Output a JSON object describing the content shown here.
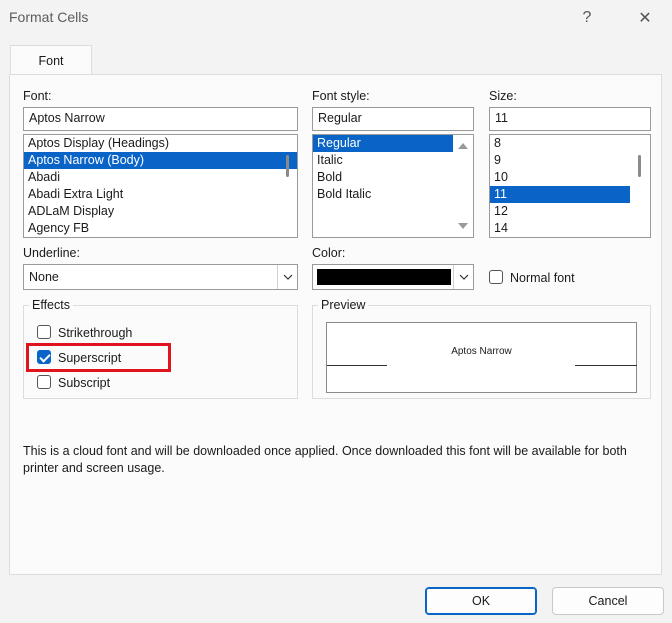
{
  "window": {
    "title": "Format Cells",
    "help_glyph": "?",
    "close_glyph": "✕"
  },
  "tabs": [
    {
      "label": "Font"
    }
  ],
  "font": {
    "label": "Font:",
    "value": "Aptos Narrow",
    "items": [
      "Aptos Display (Headings)",
      "Aptos Narrow (Body)",
      "Abadi",
      "Abadi Extra Light",
      "ADLaM Display",
      "Agency FB"
    ],
    "selected_index": 1
  },
  "font_style": {
    "label": "Font style:",
    "value": "Regular",
    "items": [
      "Regular",
      "Italic",
      "Bold",
      "Bold Italic"
    ],
    "selected_index": 0
  },
  "size": {
    "label": "Size:",
    "value": "11",
    "items": [
      "8",
      "9",
      "10",
      "11",
      "12",
      "14"
    ],
    "selected_index": 3
  },
  "underline": {
    "label": "Underline:",
    "value": "None"
  },
  "color": {
    "label": "Color:",
    "value_color": "#000000"
  },
  "normal_font": {
    "label": "Normal font",
    "checked": false
  },
  "effects": {
    "title": "Effects",
    "strikethrough": {
      "label": "Strikethrough",
      "checked": false
    },
    "superscript": {
      "label": "Superscript",
      "checked": true
    },
    "subscript": {
      "label": "Subscript",
      "checked": false
    }
  },
  "preview": {
    "title": "Preview",
    "sample_text": "Aptos Narrow"
  },
  "info_text": "This is a cloud font and will be downloaded once applied. Once downloaded this font will be available for both printer and screen usage.",
  "buttons": {
    "ok": "OK",
    "cancel": "Cancel"
  },
  "colors": {
    "selection": "#0a64c8",
    "highlight_box": "#e0141e"
  }
}
